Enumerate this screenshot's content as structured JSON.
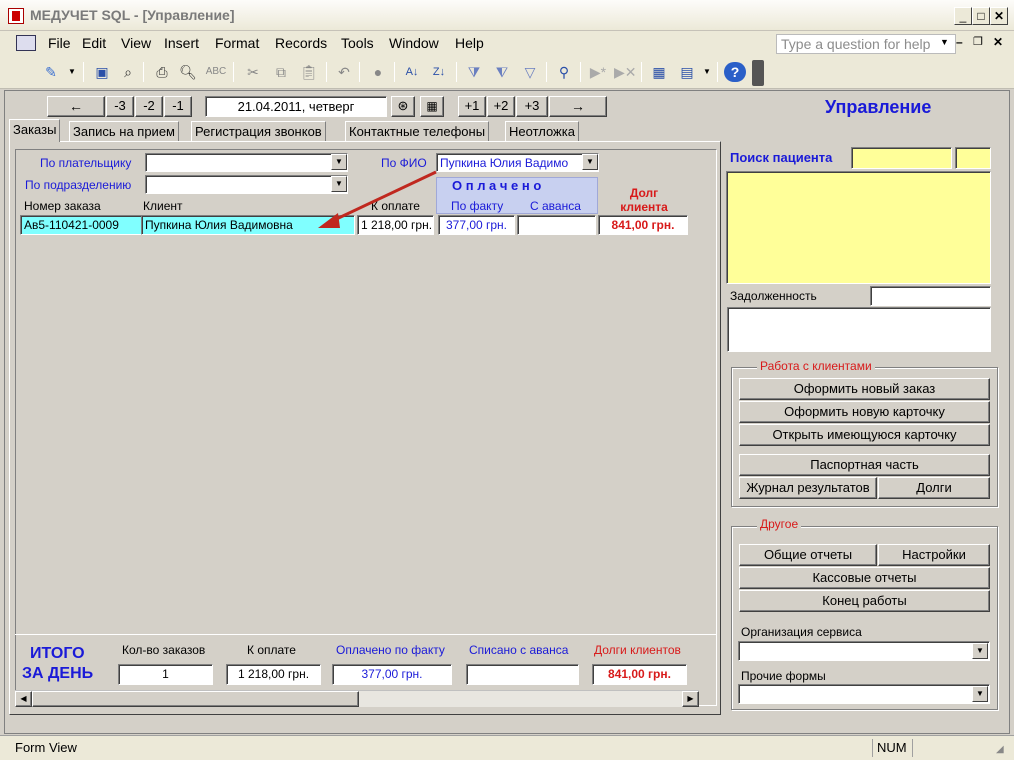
{
  "window": {
    "title": "МЕДУЧЕТ SQL - [Управление]"
  },
  "menu": {
    "items": [
      "File",
      "Edit",
      "View",
      "Insert",
      "Format",
      "Records",
      "Tools",
      "Window",
      "Help"
    ],
    "help_placeholder": "Type a question for help"
  },
  "nav": {
    "back_label": "←",
    "minus3": "-3",
    "minus2": "-2",
    "minus1": "-1",
    "date": "21.04.2011, четверг",
    "plus1": "+1",
    "plus2": "+2",
    "plus3": "+3",
    "forward_label": "→",
    "page_title": "Управление"
  },
  "tabs": [
    "Заказы",
    "Запись на прием",
    "Регистрация звонков",
    "Контактные телефоны",
    "Неотложка"
  ],
  "filters": {
    "payer_label": "По плательщику",
    "payer_value": "",
    "subdivision_label": "По подразделению",
    "subdivision_value": "",
    "fio_label": "По ФИО",
    "fio_value": "Пупкина Юлия Вадимо"
  },
  "orders_table": {
    "paid_header": "О п л а ч е н о",
    "columns": {
      "order_no": "Номер заказа",
      "client": "Клиент",
      "to_pay": "К оплате",
      "paid_fact": "По факту",
      "paid_advance": "С аванса",
      "debt": "Долг клиента"
    },
    "rows": [
      {
        "order_no": "Ав5-110421-0009",
        "client": "Пупкина Юлия Вадимовна",
        "to_pay": "1 218,00 грн.",
        "paid_fact": "377,00 грн.",
        "paid_advance": "",
        "debt": "841,00 грн."
      }
    ]
  },
  "totals": {
    "title_line1": "ИТОГО",
    "title_line2": "ЗА ДЕНЬ",
    "count_label": "Кол-во заказов",
    "count_value": "1",
    "to_pay_label": "К оплате",
    "to_pay_value": "1 218,00 грн.",
    "paid_fact_label": "Оплачено по факту",
    "paid_fact_value": "377,00 грн.",
    "advance_label": "Списано с аванса",
    "advance_value": "",
    "debt_label": "Долги клиентов",
    "debt_value": "841,00 грн."
  },
  "patient_search": {
    "label": "Поиск пациента",
    "query": "",
    "extra": "",
    "debt_label": "Задолженность",
    "debt_value": ""
  },
  "clients_group": {
    "title": "Работа с клиентами",
    "new_order": "Оформить новый заказ",
    "new_card": "Оформить новую карточку",
    "open_card": "Открыть имеющуюся карточку",
    "passport": "Паспортная часть",
    "results_log": "Журнал результатов",
    "debts": "Долги"
  },
  "other_group": {
    "title": "Другое",
    "general_reports": "Общие отчеты",
    "settings": "Настройки",
    "cash_reports": "Кассовые отчеты",
    "end_work": "Конец работы",
    "service_org_label": "Организация сервиса",
    "service_org_value": "",
    "other_forms_label": "Прочие формы",
    "other_forms_value": ""
  },
  "status": {
    "view": "Form View",
    "num": "NUM"
  },
  "colors": {
    "blue": "#1a1ad8",
    "red": "#d81a1a",
    "yellow": "#ffff99",
    "cyan": "#80ffff"
  }
}
